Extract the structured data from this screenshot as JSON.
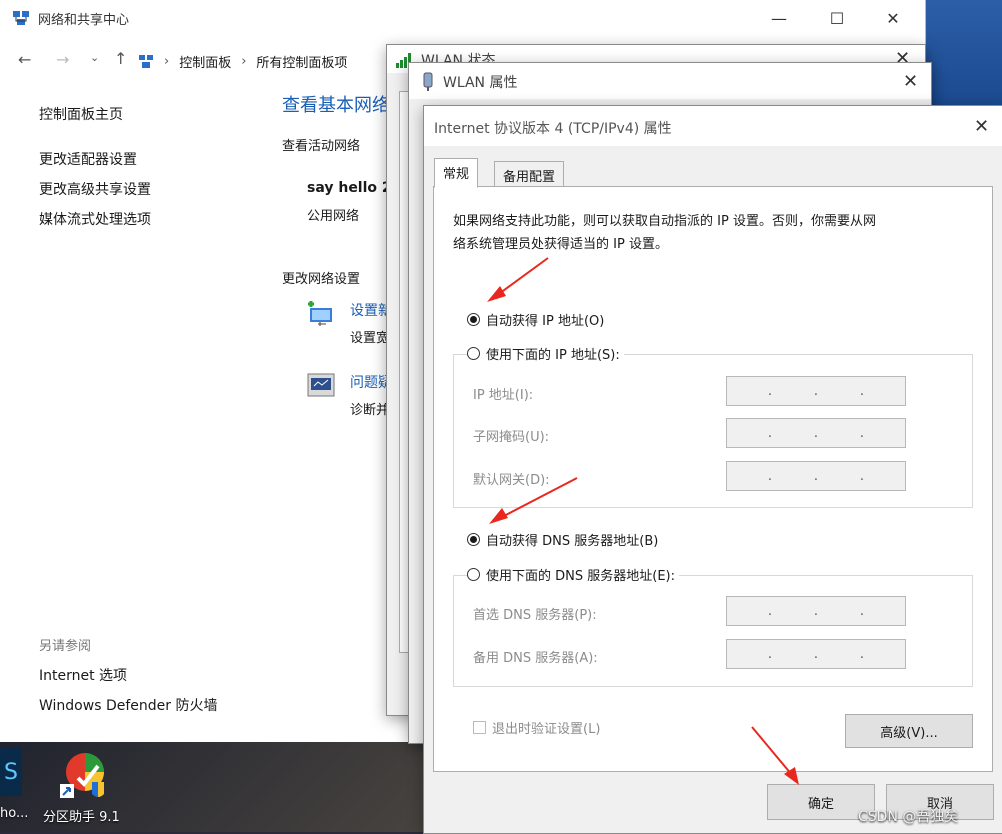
{
  "explorer": {
    "title": "网络和共享中心",
    "breadcrumb": [
      "控制面板",
      "所有控制面板项"
    ],
    "sidebar": {
      "items": [
        "控制面板主页",
        "更改适配器设置",
        "更改高级共享设置",
        "媒体流式处理选项"
      ],
      "see_also_heading": "另请参阅",
      "see_also": [
        "Internet 选项",
        "Windows Defender 防火墙"
      ]
    },
    "main": {
      "heading": "查看基本网络",
      "active_networks_label": "查看活动网络",
      "network_name": "say hello 2",
      "network_type": "公用网络",
      "change_settings_label": "更改网络设置",
      "setup_link": "设置新",
      "setup_desc": "设置宽",
      "troubleshoot_link": "问题疑",
      "troubleshoot_desc": "诊断并"
    }
  },
  "wlan_status": {
    "title": "WLAN 状态"
  },
  "wlan_props": {
    "title": "WLAN 属性"
  },
  "ipv4": {
    "title": "Internet 协议版本 4 (TCP/IPv4) 属性",
    "tabs": [
      "常规",
      "备用配置"
    ],
    "intro": [
      "如果网络支持此功能，则可以获取自动指派的 IP 设置。否则，你需要从网",
      "络系统管理员处获得适当的 IP 设置。"
    ],
    "auto_ip": "自动获得 IP 地址(O)",
    "manual_ip": "使用下面的 IP 地址(S):",
    "ip_label": "IP 地址(I):",
    "subnet_label": "子网掩码(U):",
    "gateway_label": "默认网关(D):",
    "auto_dns": "自动获得 DNS 服务器地址(B)",
    "manual_dns": "使用下面的 DNS 服务器地址(E):",
    "preferred_dns_label": "首选 DNS 服务器(P):",
    "alternate_dns_label": "备用 DNS 服务器(A):",
    "validate_label": "退出时验证设置(L)",
    "advanced_button": "高级(V)...",
    "ok_button": "确定",
    "cancel_button": "取消",
    "ip_dot": "."
  },
  "desktop": {
    "partition_label": "分区助手 9.1",
    "left_edge_label": "ho...",
    "watermark": "CSDN @吾独矣"
  },
  "colors": {
    "accent": "#1a5fb4",
    "arrow": "#e8281f"
  }
}
